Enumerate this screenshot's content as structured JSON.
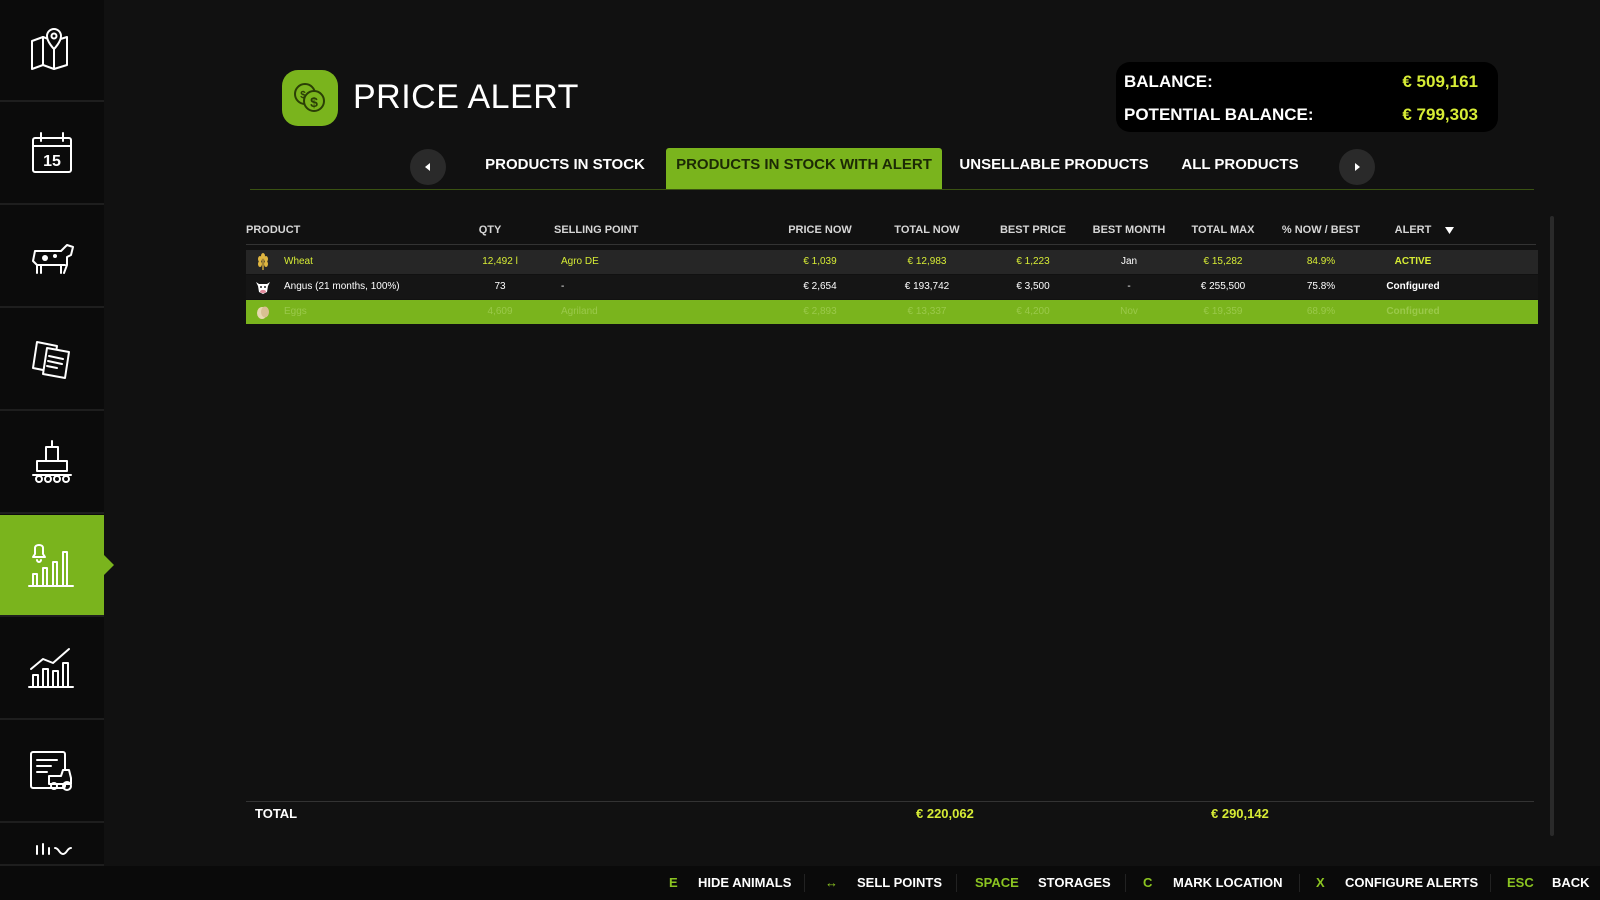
{
  "colors": {
    "accent": "#7ab41d",
    "value_yellow": "#d7ec35",
    "background": "#111111"
  },
  "sidebar": {
    "items": [
      {
        "icon": "map-pin-icon"
      },
      {
        "icon": "calendar-icon",
        "day": "15"
      },
      {
        "icon": "cow-icon"
      },
      {
        "icon": "contracts-icon"
      },
      {
        "icon": "production-icon"
      },
      {
        "icon": "price-alert-icon",
        "active": true
      },
      {
        "icon": "statistics-icon"
      },
      {
        "icon": "vehicle-list-icon"
      },
      {
        "icon": "more-icon"
      }
    ]
  },
  "header": {
    "title": "PRICE ALERT",
    "logo_icon": "coins-icon",
    "balance_label": "BALANCE:",
    "balance_value": "€ 509,161",
    "potential_label": "POTENTIAL BALANCE:",
    "potential_value": "€ 799,303"
  },
  "tabs": {
    "prev_icon": "arrow-left-icon",
    "next_icon": "arrow-right-icon",
    "items": [
      {
        "label": "PRODUCTS IN STOCK"
      },
      {
        "label": "PRODUCTS IN STOCK WITH ALERT",
        "active": true
      },
      {
        "label": "UNSELLABLE PRODUCTS"
      },
      {
        "label": "ALL PRODUCTS"
      }
    ]
  },
  "table": {
    "columns": {
      "product": "PRODUCT",
      "qty": "QTY",
      "selling_point": "SELLING POINT",
      "price_now": "PRICE NOW",
      "total_now": "TOTAL NOW",
      "best_price": "BEST PRICE",
      "best_month": "BEST MONTH",
      "total_max": "TOTAL MAX",
      "pct": "% NOW / BEST",
      "alert": "ALERT"
    },
    "sort_icon": "sort-down-icon",
    "rows": [
      {
        "icon": "wheat-icon",
        "product": "Wheat",
        "qty": "12,492 l",
        "selling_point": "Agro DE",
        "price_now": "€ 1,039",
        "total_now": "€ 12,983",
        "best_price": "€ 1,223",
        "best_month": "Jan",
        "total_max": "€ 15,282",
        "pct": "84.9%",
        "alert": "ACTIVE"
      },
      {
        "icon": "cow-head-icon",
        "product": "Angus (21 months, 100%)",
        "qty": "73",
        "selling_point": "-",
        "price_now": "€ 2,654",
        "total_now": "€ 193,742",
        "best_price": "€ 3,500",
        "best_month": "-",
        "total_max": "€ 255,500",
        "pct": "75.8%",
        "alert": "Configured"
      },
      {
        "icon": "egg-icon",
        "product": "Eggs",
        "qty": "4,609",
        "selling_point": "Agriland",
        "price_now": "€ 2,893",
        "total_now": "€ 13,337",
        "best_price": "€ 4,200",
        "best_month": "Nov",
        "total_max": "€ 19,359",
        "pct": "68.9%",
        "alert": "Configured"
      }
    ],
    "total_label": "TOTAL",
    "total_now": "€ 220,062",
    "total_max": "€ 290,142"
  },
  "bottombar": {
    "actions": [
      {
        "key": "E",
        "label": "HIDE ANIMALS"
      },
      {
        "key": "↔",
        "label": "SELL POINTS"
      },
      {
        "key": "SPACE",
        "label": "STORAGES"
      },
      {
        "key": "C",
        "label": "MARK LOCATION"
      },
      {
        "key": "X",
        "label": "CONFIGURE ALERTS"
      },
      {
        "key": "ESC",
        "label": "BACK"
      }
    ]
  }
}
